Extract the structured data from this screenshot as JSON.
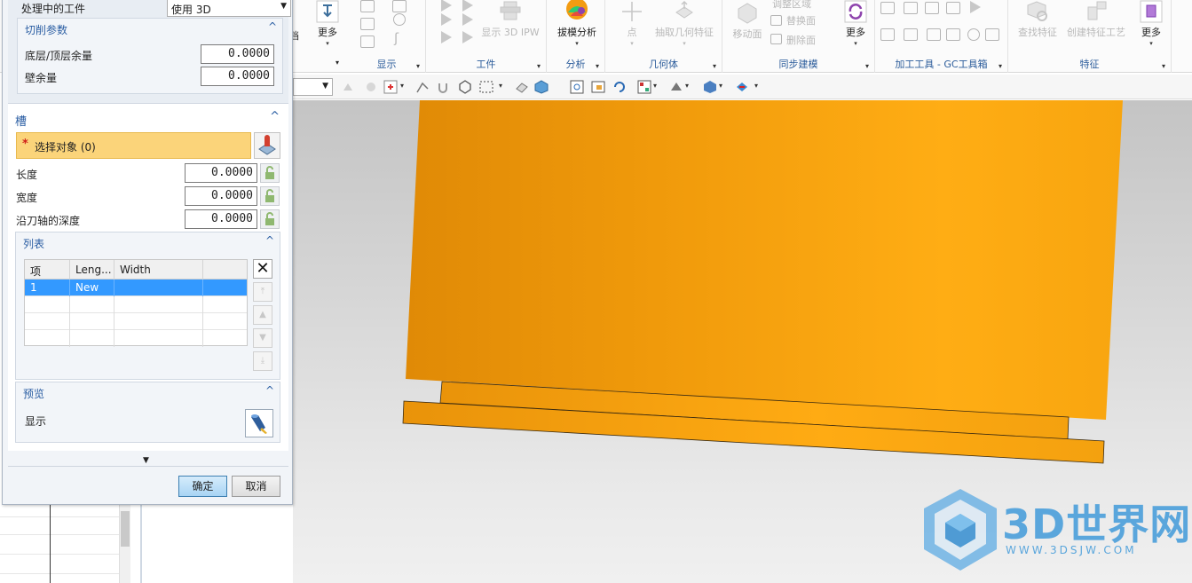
{
  "ribbon": {
    "groups": [
      {
        "label": "显示"
      },
      {
        "label": "工件"
      },
      {
        "label": "分析"
      },
      {
        "label": "几何体"
      },
      {
        "label": "同步建模"
      },
      {
        "label": "加工工具 - GC工具箱"
      },
      {
        "label": "特征"
      }
    ],
    "buttons": {
      "partial_left": "档",
      "more1": "更多",
      "show_3d_ipw": "显示 3D IPW",
      "draft_analysis": "拔模分析",
      "point": "点",
      "extract_geometry": "抽取几何特征",
      "move_face": "移动面",
      "adjust_region": "调整区域",
      "replace_face": "替换面",
      "delete_face": "删除面",
      "more2": "更多",
      "find_feature": "查找特征",
      "create_feature_process": "创建特征工艺",
      "more3": "更多"
    }
  },
  "dialog": {
    "workpiece_label": "处理中的工件",
    "workpiece_value": "使用 3D",
    "cut_params": {
      "title": "切削参数",
      "floor_label": "底层/顶层余量",
      "floor_value": "0.0000",
      "wall_label": "壁余量",
      "wall_value": "0.0000"
    },
    "slot": {
      "title": "槽",
      "select_label": "选择对象 (0)",
      "length_label": "长度",
      "length_value": "0.0000",
      "width_label": "宽度",
      "width_value": "0.0000",
      "depth_label": "沿刀轴的深度",
      "depth_value": "0.0000"
    },
    "list": {
      "title": "列表",
      "columns": [
        "项",
        "Leng...",
        "Width",
        ""
      ],
      "rows": [
        {
          "item": "1",
          "length": "New",
          "width": "",
          "extra": ""
        }
      ]
    },
    "preview": {
      "title": "预览",
      "show_label": "显示"
    },
    "ok": "确定",
    "cancel": "取消"
  },
  "watermark": {
    "text": "3D世界网",
    "url": "WWW.3DSJW.COM"
  },
  "colors": {
    "accent": "#2b5ea3",
    "selection": "#3399ff",
    "required": "#fbd47a",
    "model": "#f5a20a"
  }
}
